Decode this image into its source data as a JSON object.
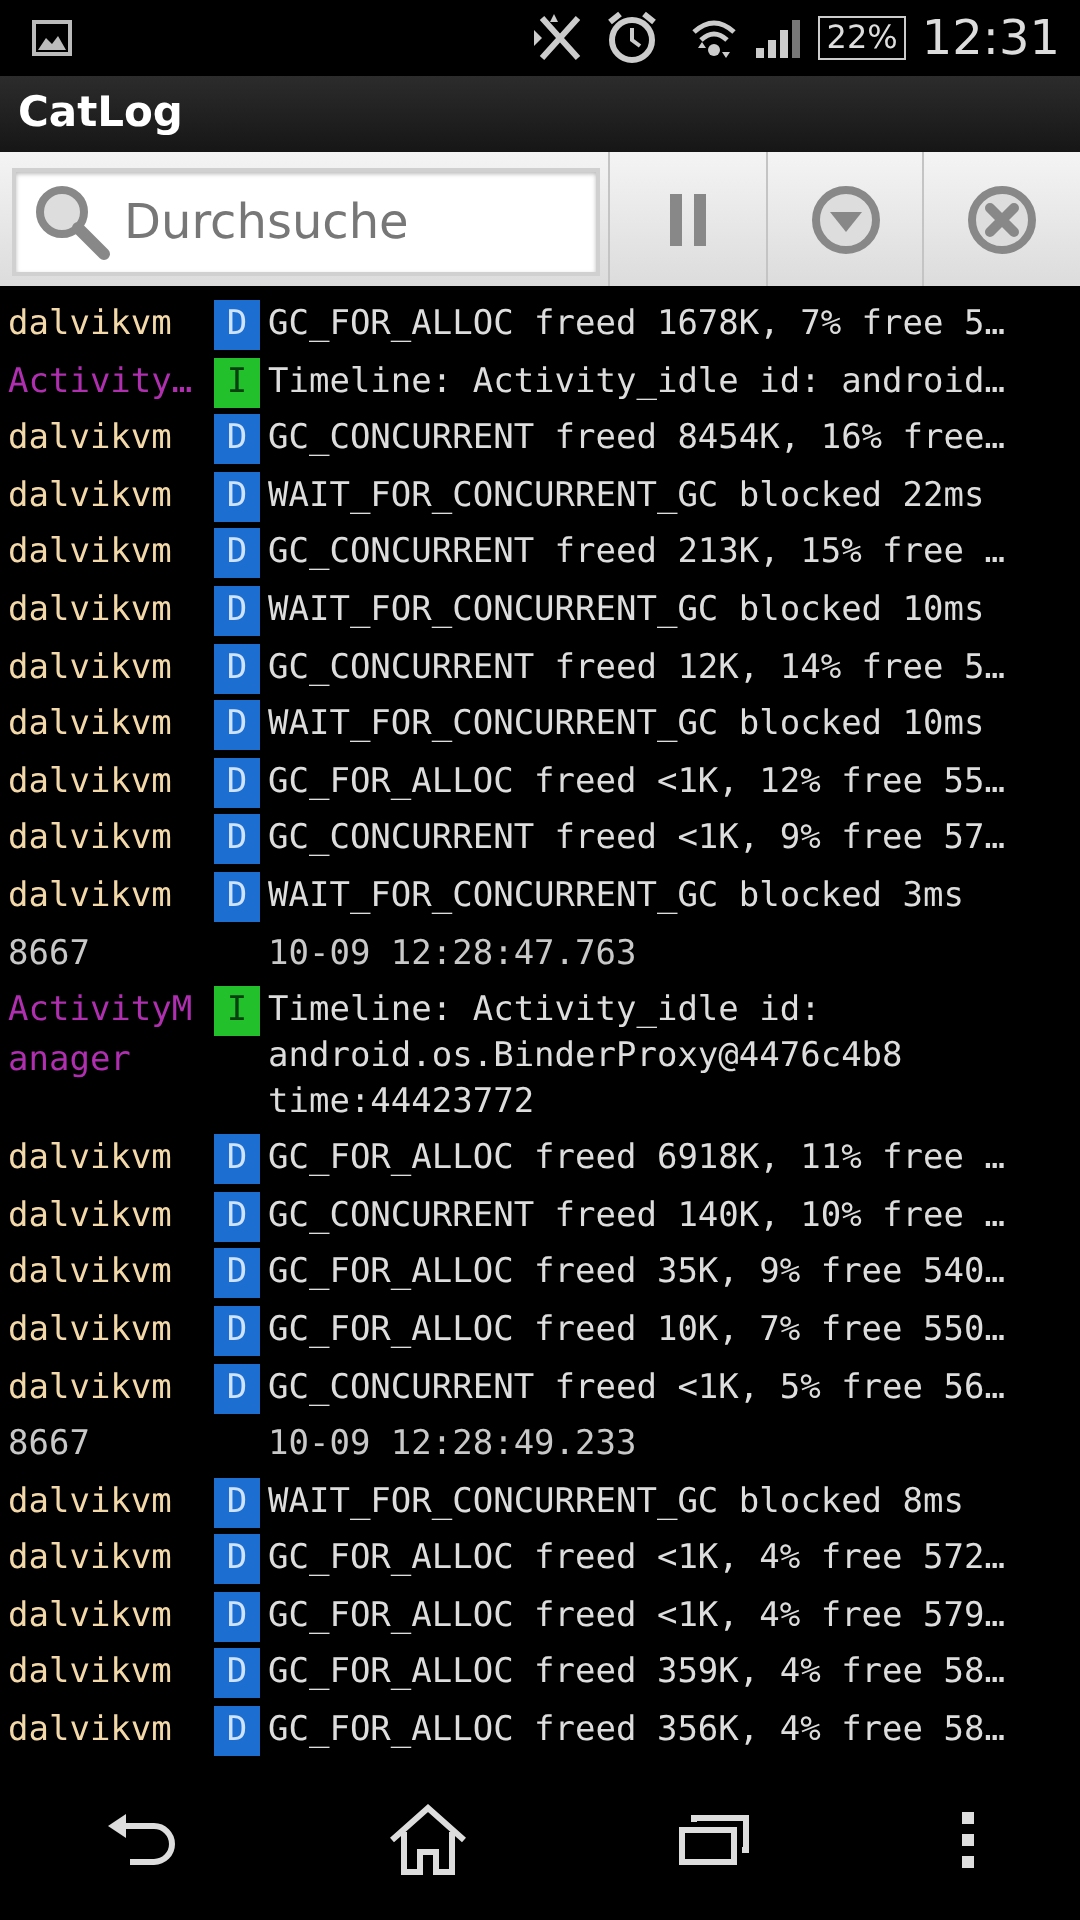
{
  "status_bar": {
    "battery": "22%",
    "time": "12:31"
  },
  "title": "CatLog",
  "search": {
    "placeholder": "Durchsuche"
  },
  "log": [
    {
      "kind": "entry",
      "tag": "dalvikvm",
      "color": "#f3d9a9",
      "level": "D",
      "message": "GC_FOR_ALLOC freed 1678K, 7% free 5…"
    },
    {
      "kind": "entry",
      "tag": "Activity…",
      "color": "#b02fb0",
      "level": "I",
      "message": "Timeline: Activity_idle id: android…"
    },
    {
      "kind": "entry",
      "tag": "dalvikvm",
      "color": "#f3d9a9",
      "level": "D",
      "message": "GC_CONCURRENT freed 8454K, 16% free…"
    },
    {
      "kind": "entry",
      "tag": "dalvikvm",
      "color": "#f3d9a9",
      "level": "D",
      "message": "WAIT_FOR_CONCURRENT_GC blocked 22ms"
    },
    {
      "kind": "entry",
      "tag": "dalvikvm",
      "color": "#f3d9a9",
      "level": "D",
      "message": "GC_CONCURRENT freed 213K, 15% free …"
    },
    {
      "kind": "entry",
      "tag": "dalvikvm",
      "color": "#f3d9a9",
      "level": "D",
      "message": "WAIT_FOR_CONCURRENT_GC blocked 10ms"
    },
    {
      "kind": "entry",
      "tag": "dalvikvm",
      "color": "#f3d9a9",
      "level": "D",
      "message": "GC_CONCURRENT freed 12K, 14% free 5…"
    },
    {
      "kind": "entry",
      "tag": "dalvikvm",
      "color": "#f3d9a9",
      "level": "D",
      "message": "WAIT_FOR_CONCURRENT_GC blocked 10ms"
    },
    {
      "kind": "entry",
      "tag": "dalvikvm",
      "color": "#f3d9a9",
      "level": "D",
      "message": "GC_FOR_ALLOC freed <1K, 12% free 55…"
    },
    {
      "kind": "entry",
      "tag": "dalvikvm",
      "color": "#f3d9a9",
      "level": "D",
      "message": "GC_CONCURRENT freed <1K, 9% free 57…"
    },
    {
      "kind": "entry",
      "tag": "dalvikvm",
      "color": "#f3d9a9",
      "level": "D",
      "message": "WAIT_FOR_CONCURRENT_GC blocked 3ms"
    },
    {
      "kind": "separator",
      "pid": "8667",
      "timestamp": "10-09 12:28:47.763"
    },
    {
      "kind": "entry",
      "tag": "ActivityManager",
      "color": "#b02fb0",
      "level": "I",
      "message": "Timeline: Activity_idle id: android.os.BinderProxy@4476c4b8 time:44423772"
    },
    {
      "kind": "entry",
      "tag": "dalvikvm",
      "color": "#f3d9a9",
      "level": "D",
      "message": "GC_FOR_ALLOC freed 6918K, 11% free …"
    },
    {
      "kind": "entry",
      "tag": "dalvikvm",
      "color": "#f3d9a9",
      "level": "D",
      "message": "GC_CONCURRENT freed 140K, 10% free …"
    },
    {
      "kind": "entry",
      "tag": "dalvikvm",
      "color": "#f3d9a9",
      "level": "D",
      "message": "GC_FOR_ALLOC freed 35K, 9% free 540…"
    },
    {
      "kind": "entry",
      "tag": "dalvikvm",
      "color": "#f3d9a9",
      "level": "D",
      "message": "GC_FOR_ALLOC freed 10K, 7% free 550…"
    },
    {
      "kind": "entry",
      "tag": "dalvikvm",
      "color": "#f3d9a9",
      "level": "D",
      "message": "GC_CONCURRENT freed <1K, 5% free 56…"
    },
    {
      "kind": "separator",
      "pid": "8667",
      "timestamp": "10-09 12:28:49.233"
    },
    {
      "kind": "entry",
      "tag": "dalvikvm",
      "color": "#f3d9a9",
      "level": "D",
      "message": "WAIT_FOR_CONCURRENT_GC blocked 8ms"
    },
    {
      "kind": "entry",
      "tag": "dalvikvm",
      "color": "#f3d9a9",
      "level": "D",
      "message": "GC_FOR_ALLOC freed <1K, 4% free 572…"
    },
    {
      "kind": "entry",
      "tag": "dalvikvm",
      "color": "#f3d9a9",
      "level": "D",
      "message": "GC_FOR_ALLOC freed <1K, 4% free 579…"
    },
    {
      "kind": "entry",
      "tag": "dalvikvm",
      "color": "#f3d9a9",
      "level": "D",
      "message": "GC_FOR_ALLOC freed 359K, 4% free 58…"
    },
    {
      "kind": "entry",
      "tag": "dalvikvm",
      "color": "#f3d9a9",
      "level": "D",
      "message": "GC_FOR_ALLOC freed 356K, 4% free 58…"
    }
  ]
}
